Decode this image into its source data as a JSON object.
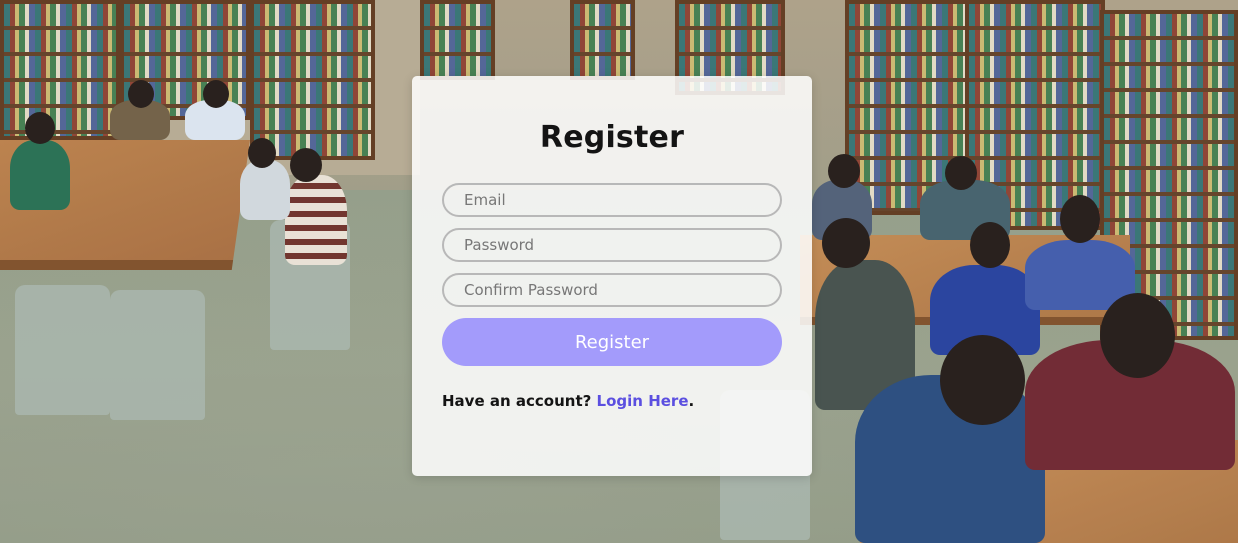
{
  "form": {
    "title": "Register",
    "email_placeholder": "Email",
    "password_placeholder": "Password",
    "confirm_placeholder": "Confirm Password",
    "submit_label": "Register",
    "footer_prefix": "Have an account? ",
    "login_link": "Login Here",
    "footer_suffix": "."
  },
  "colors": {
    "button_bg": "#a39bfb",
    "link": "#5b4fe0",
    "card_bg": "rgba(255,255,255,0.86)"
  }
}
